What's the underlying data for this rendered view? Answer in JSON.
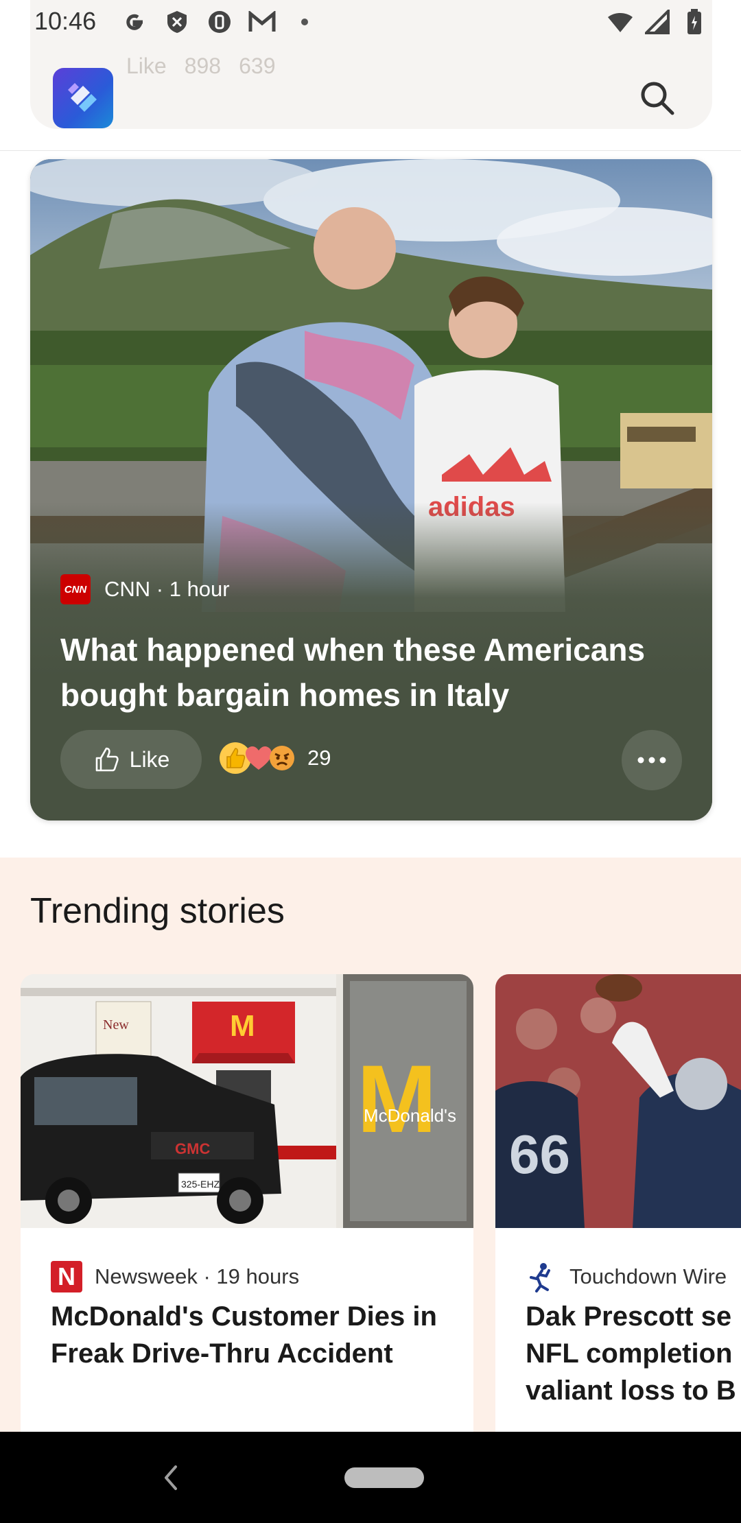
{
  "status_bar": {
    "time": "10:46",
    "left_icons": [
      "google-icon",
      "shield-icon",
      "vpn-icon",
      "gmail-icon",
      "dot-icon"
    ],
    "right_icons": [
      "wifi-icon",
      "signal-icon",
      "battery-icon"
    ]
  },
  "header": {
    "ghost_like": "Like",
    "ghost_reactions": "898",
    "ghost_comments": "639",
    "search_icon": "search-icon"
  },
  "hero": {
    "source": "CNN",
    "time": "1 hour",
    "source_line": "CNN · 1 hour",
    "title": "What happened when these Americans bought bargain homes in Italy",
    "like_label": "Like",
    "reaction_count": "29",
    "more_icon": "more-horizontal-icon"
  },
  "trending": {
    "title": "Trending stories",
    "cards": [
      {
        "source_line": "Newsweek · 19 hours",
        "headline": "McDonald's Customer Dies in Freak Drive-Thru Accident",
        "image_sign_text": "McDonald's",
        "image_plate_text": "325-EHZ",
        "image_car_text": "GMC",
        "image_window_text": "New"
      },
      {
        "source_line": "Touchdown Wire",
        "headline_lines": [
          "Dak Prescott se",
          "NFL completion",
          "valiant loss to B"
        ],
        "image_jersey_text": "66"
      }
    ]
  },
  "colors": {
    "hero_bg": "#485241",
    "trending_bg": "#fdf0e8",
    "cnn_red": "#cc0000",
    "newsweek_red": "#d31f28"
  }
}
